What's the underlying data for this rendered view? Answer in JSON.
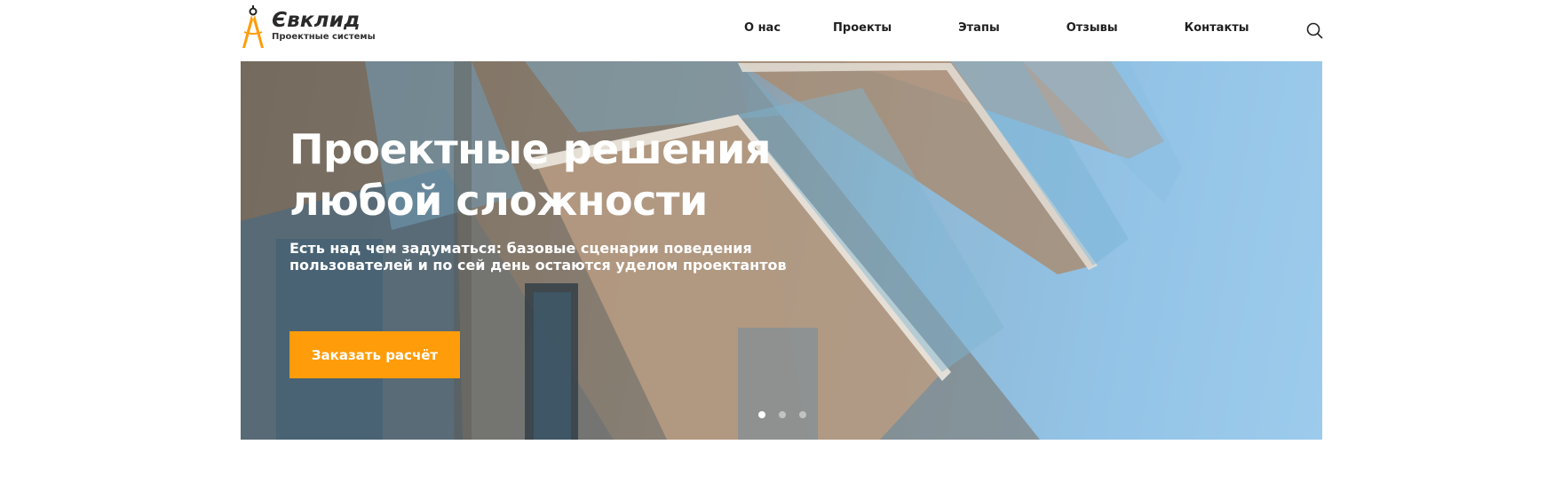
{
  "brand": {
    "name": "Євклид",
    "tagline": "Проектные системы",
    "accent_color": "#ff9c0a",
    "logo_icon": "compass-icon"
  },
  "nav": {
    "items": [
      {
        "label": "О нас"
      },
      {
        "label": "Проекты"
      },
      {
        "label": "Этапы"
      },
      {
        "label": "Отзывы"
      },
      {
        "label": "Контакты"
      }
    ],
    "search_icon": "search-icon"
  },
  "hero": {
    "title_line1": "Проектные решения",
    "title_line2": "любой сложности",
    "subtitle_line1": "Есть над чем задуматься: базовые сценарии поведения",
    "subtitle_line2": "пользователей и по сей день остаются уделом проектантов",
    "cta_label": "Заказать расчёт",
    "slider": {
      "total": 3,
      "active": 1
    }
  }
}
